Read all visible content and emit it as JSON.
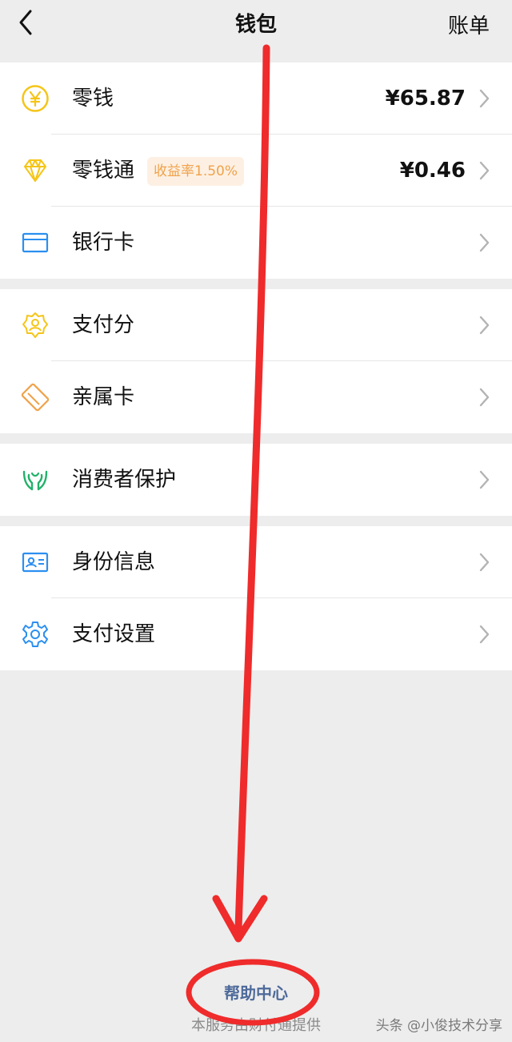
{
  "header": {
    "title": "钱包",
    "right_label": "账单",
    "back_icon": "back-chevron-icon"
  },
  "groups": [
    [
      {
        "label": "零钱",
        "value": "¥65.87",
        "icon": "yen-coin-icon",
        "color": "#f5c518"
      },
      {
        "label": "零钱通",
        "badge": "收益率1.50%",
        "value": "¥0.46",
        "icon": "diamond-icon",
        "color": "#f5c518"
      },
      {
        "label": "银行卡",
        "icon": "bank-card-icon",
        "color": "#2b8ff0"
      }
    ],
    [
      {
        "label": "支付分",
        "icon": "credit-score-icon",
        "color": "#f5c518"
      },
      {
        "label": "亲属卡",
        "icon": "family-card-icon",
        "color": "#f0a24a"
      }
    ],
    [
      {
        "label": "消费者保护",
        "icon": "hands-protect-icon",
        "color": "#21b16a"
      }
    ],
    [
      {
        "label": "身份信息",
        "icon": "id-card-icon",
        "color": "#2b8ff0"
      },
      {
        "label": "支付设置",
        "icon": "settings-gear-icon",
        "color": "#2b8ff0"
      }
    ]
  ],
  "footer": {
    "help_center": "帮助中心",
    "provider": "本服务由财付通提供"
  },
  "watermark": "头条 @小俊技术分享",
  "annotation_color": "#ef2b2b"
}
